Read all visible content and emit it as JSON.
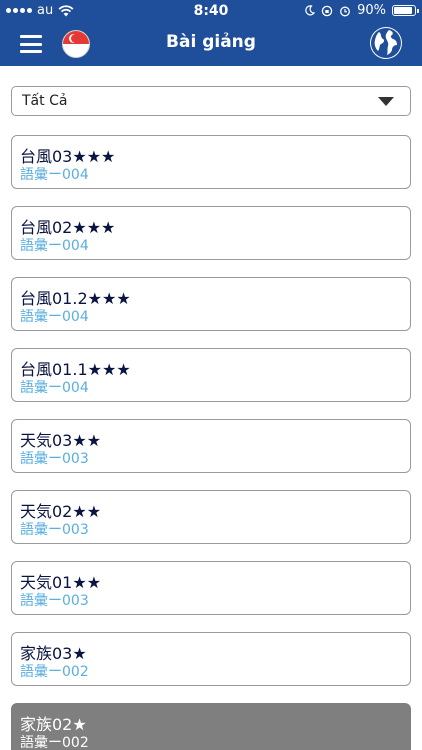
{
  "status_bar": {
    "carrier": "au",
    "time": "8:40",
    "battery": "90%",
    "battery_level": 0.9
  },
  "nav": {
    "title": "Bài giảng",
    "menu_icon": "hamburger-icon",
    "flag_icon": "singapore-flag-icon",
    "globe_icon": "globe-icon"
  },
  "filter": {
    "selected": "Tất Cả"
  },
  "lessons": [
    {
      "title": "台風03★★★",
      "subtitle": "語彙ー004"
    },
    {
      "title": "台風02★★★",
      "subtitle": "語彙ー004"
    },
    {
      "title": "台風01.2★★★",
      "subtitle": "語彙ー004"
    },
    {
      "title": "台風01.1★★★",
      "subtitle": "語彙ー004"
    },
    {
      "title": "天気03★★",
      "subtitle": "語彙ー003"
    },
    {
      "title": "天気02★★",
      "subtitle": "語彙ー003"
    },
    {
      "title": "天気01★★",
      "subtitle": "語彙ー003"
    },
    {
      "title": "家族03★",
      "subtitle": "語彙ー002"
    },
    {
      "title": "家族02★",
      "subtitle": "語彙ー002"
    }
  ],
  "colors": {
    "header": "#1f4e9a",
    "title_text": "#0a1440",
    "subtitle_text": "#5aaee0",
    "selected_card": "#7f7f7f"
  }
}
